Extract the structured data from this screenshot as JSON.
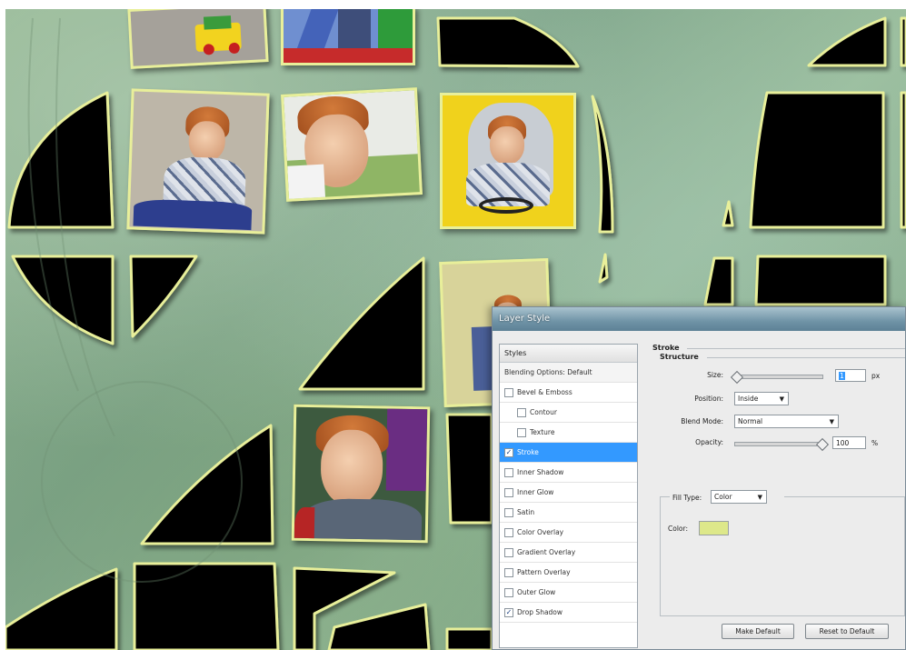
{
  "dialog": {
    "title": "Layer Style",
    "styles_header": "Styles",
    "blending_label": "Blending Options: Default",
    "effects": [
      {
        "label": "Bevel & Emboss",
        "checked": false,
        "indent": 0,
        "selected": false
      },
      {
        "label": "Contour",
        "checked": false,
        "indent": 1,
        "selected": false
      },
      {
        "label": "Texture",
        "checked": false,
        "indent": 1,
        "selected": false
      },
      {
        "label": "Stroke",
        "checked": true,
        "indent": 0,
        "selected": true
      },
      {
        "label": "Inner Shadow",
        "checked": false,
        "indent": 0,
        "selected": false
      },
      {
        "label": "Inner Glow",
        "checked": false,
        "indent": 0,
        "selected": false
      },
      {
        "label": "Satin",
        "checked": false,
        "indent": 0,
        "selected": false
      },
      {
        "label": "Color Overlay",
        "checked": false,
        "indent": 0,
        "selected": false
      },
      {
        "label": "Gradient Overlay",
        "checked": false,
        "indent": 0,
        "selected": false
      },
      {
        "label": "Pattern Overlay",
        "checked": false,
        "indent": 0,
        "selected": false
      },
      {
        "label": "Outer Glow",
        "checked": false,
        "indent": 0,
        "selected": false
      },
      {
        "label": "Drop Shadow",
        "checked": true,
        "indent": 0,
        "selected": false
      }
    ],
    "stroke": {
      "section_title": "Stroke",
      "structure_title": "Structure",
      "size_label": "Size:",
      "size_value": "1",
      "size_unit": "px",
      "position_label": "Position:",
      "position_value": "Inside",
      "blend_label": "Blend Mode:",
      "blend_value": "Normal",
      "opacity_label": "Opacity:",
      "opacity_value": "100",
      "opacity_unit": "%",
      "opacity_fraction": 1.0,
      "size_fraction": 0.02,
      "fill_type_label": "Fill Type:",
      "fill_type_value": "Color",
      "color_label": "Color:",
      "stroke_color": "#dde88a"
    },
    "buttons": {
      "make_default": "Make Default",
      "reset_default": "Reset to Default"
    }
  },
  "colors": {
    "tile_border": "#e8ef9a",
    "tile_fill": "#000000",
    "selection": "#3399ff"
  }
}
